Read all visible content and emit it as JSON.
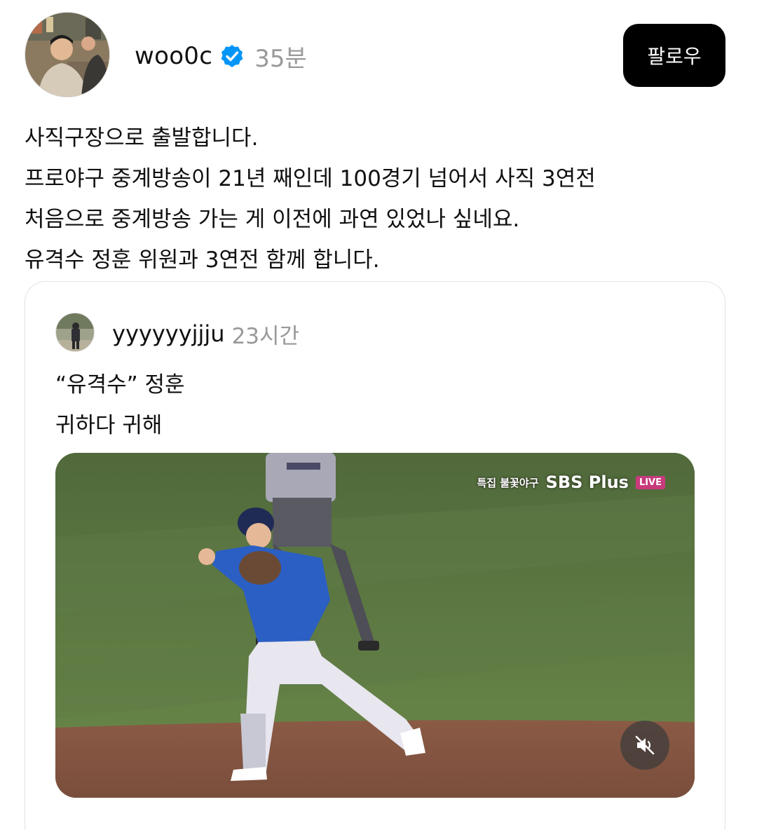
{
  "post": {
    "username": "woo0c",
    "verified": true,
    "timestamp": "35분",
    "follow_label": "팔로우",
    "body_lines": [
      "사직구장으로 출발합니다.",
      "프로야구 중계방송이 21년 째인데 100경기 넘어서 사직 3연전",
      "처음으로 중계방송 가는 게 이전에 과연 있었나 싶네요.",
      "유격수 정훈 위원과 3연전 함께 합니다."
    ]
  },
  "quoted": {
    "username": "yyyyyyjjju",
    "timestamp": "23시간",
    "body_lines": [
      "“유격수” 정훈",
      "귀하다 귀해"
    ],
    "video": {
      "broadcast_tag": "특집 불꽃야구",
      "channel": "SBS Plus",
      "live_badge": "LIVE",
      "muted_icon": "speaker-muted-icon"
    }
  },
  "colors": {
    "verified": "#0095f6",
    "follow_bg": "#000000",
    "muted_text": "#999999",
    "live_badge": "#c83a7c"
  }
}
